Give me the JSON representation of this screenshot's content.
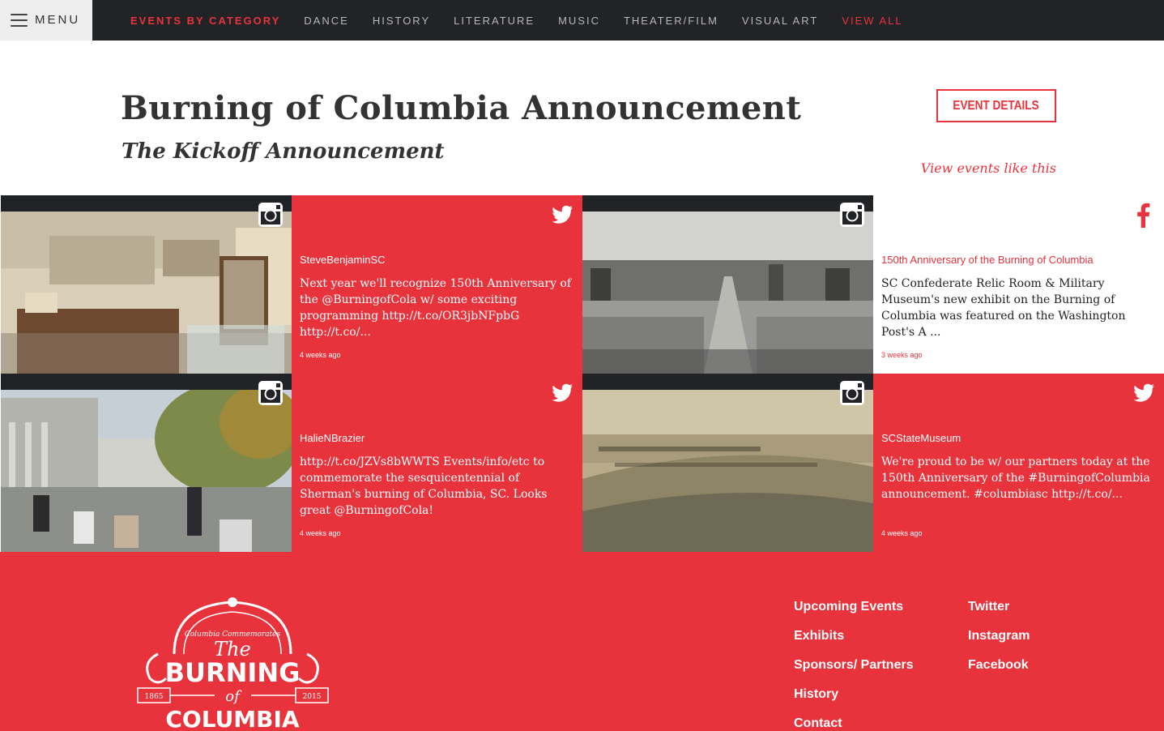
{
  "nav": {
    "menu_label": "MENU",
    "links": [
      {
        "label": "EVENTS BY CATEGORY"
      },
      {
        "label": "DANCE"
      },
      {
        "label": "HISTORY"
      },
      {
        "label": "LITERATURE"
      },
      {
        "label": "MUSIC"
      },
      {
        "label": "THEATER/FILM"
      },
      {
        "label": "VISUAL ART"
      },
      {
        "label": "VIEW ALL"
      }
    ]
  },
  "header": {
    "title": "Burning of Columbia Announcement",
    "subtitle": "The Kickoff Announcement",
    "event_details_label": "EVENT DETAILS",
    "view_like_label": "View events like this"
  },
  "posts": [
    {
      "type": "instagram-photo",
      "icon": "instagram-icon"
    },
    {
      "type": "twitter",
      "icon": "twitter-icon",
      "author": "SteveBenjaminSC",
      "body": "Next year we'll recognize 150th Anniversary of the @BurningofCola w/ some exciting programming http://t.co/OR3jbNFpbG http://t.co/...",
      "time": "4 weeks ago"
    },
    {
      "type": "instagram-photo",
      "icon": "instagram-icon"
    },
    {
      "type": "facebook",
      "icon": "facebook-icon",
      "author": "150th Anniversary of the Burning of Columbia",
      "body": "SC Confederate Relic Room & Military Museum's new exhibit on the Burning of Columbia was featured on the Washington Post's A ...",
      "time": "3 weeks ago"
    },
    {
      "type": "instagram-photo",
      "icon": "instagram-icon"
    },
    {
      "type": "twitter",
      "icon": "twitter-icon",
      "author": "HalieNBrazier",
      "body": "http://t.co/JZVs8bWWTS Events/info/etc to commemorate the sesquicentennial of Sherman's burning of Columbia, SC. Looks great @BurningofCola!",
      "time": "4 weeks ago"
    },
    {
      "type": "instagram-photo",
      "icon": "instagram-icon"
    },
    {
      "type": "twitter",
      "icon": "twitter-icon",
      "author": "SCStateMuseum",
      "body": "We're proud to be w/ our partners today at the 150th Anniversary of the #BurningofColumbia announcement. #columbiasc http://t.co/...",
      "time": "4 weeks ago"
    }
  ],
  "footer": {
    "logo": {
      "top_text": "Columbia Commemorates",
      "the": "The",
      "burning": "BURNING",
      "of": "of",
      "columbia": "COLUMBIA",
      "year_left": "1865",
      "year_right": "2015"
    },
    "col1": [
      "Upcoming Events",
      "Exhibits",
      "Sponsors/ Partners",
      "History",
      "Contact"
    ],
    "col2": [
      "Twitter",
      "Instagram",
      "Facebook"
    ]
  },
  "colors": {
    "accent": "#e8333d",
    "dark": "#222326",
    "menu_bg": "#ededed"
  }
}
